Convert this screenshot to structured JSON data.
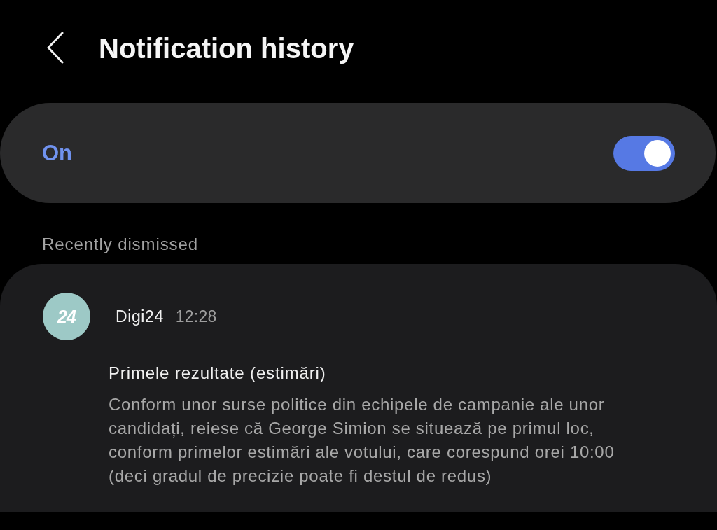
{
  "header": {
    "title": "Notification history"
  },
  "master_switch": {
    "label": "On",
    "on": true
  },
  "sections": [
    {
      "heading": "Recently dismissed",
      "notifications": [
        {
          "app_icon_text": "24",
          "app": "Digi24",
          "time": "12:28",
          "title": "Primele rezultate (estimări)",
          "body": "Conform unor surse politice din echipele de campanie ale unor candidați, reiese că George Simion se situează pe primul loc, conform primelor estimări ale votului, care corespund orei 10:00 (deci gradul de precizie poate fi destul de redus)"
        }
      ]
    }
  ]
}
